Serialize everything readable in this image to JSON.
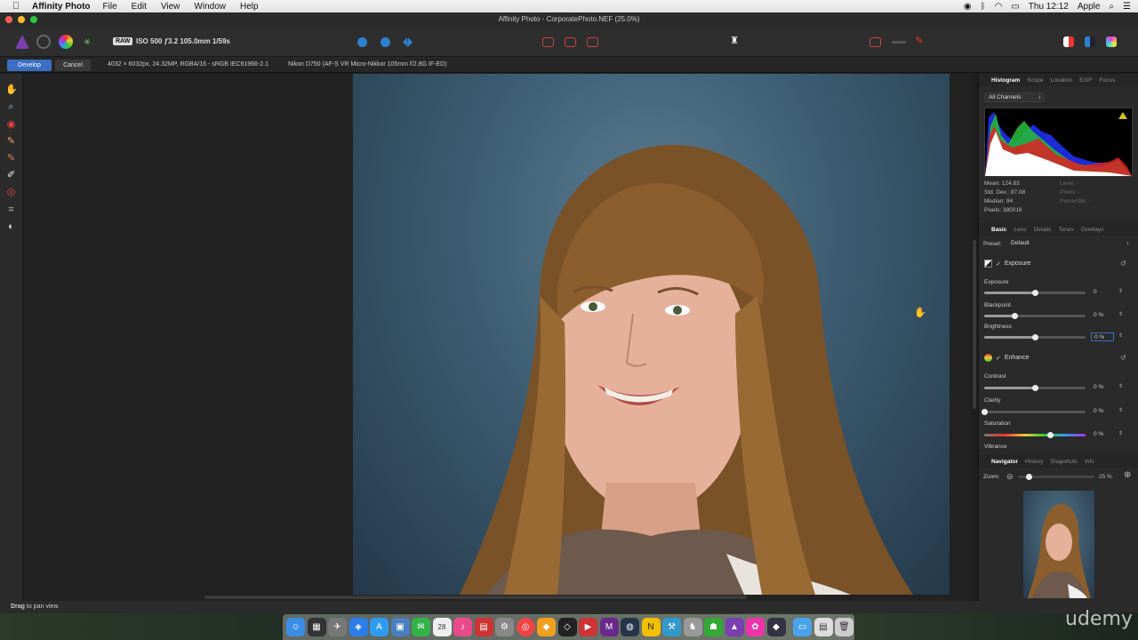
{
  "menubar": {
    "apple_icon": "",
    "app_name": "Affinity Photo",
    "items": [
      "File",
      "Edit",
      "View",
      "Window",
      "Help"
    ],
    "clock": "Thu 12:12",
    "user": "Apple"
  },
  "window": {
    "title": "Affinity Photo - CorporatePhoto.NEF (25.0%)"
  },
  "toolbar": {
    "raw_badge": "RAW",
    "exif_summary": "ISO 500 ƒ3.2 105.0mm 1/59s"
  },
  "context": {
    "develop_label": "Develop",
    "cancel_label": "Cancel",
    "image_info": "4032 × 6032px, 24.32MP, RGBA/16 - sRGB IEC61966-2.1",
    "camera_info": "Nikon D750 (AF-S VR Micro-Nikkor 105mm f/2.8G IF-ED)"
  },
  "histogram_panel": {
    "tabs": [
      "Histogram",
      "Scope",
      "Location",
      "EXIF",
      "Focus"
    ],
    "channel": "All Channels",
    "stats": {
      "mean": "Mean: 124.83",
      "std_dev": "Std. Dev.: 87.08",
      "median": "Median: 94",
      "pixels": "Pixels: 380016",
      "level": "Level: -",
      "pixels_sel": "Pixels: -",
      "percentile": "Percentile: -"
    }
  },
  "develop_panel": {
    "tabs": [
      "Basic",
      "Lens",
      "Details",
      "Tones",
      "Overlays"
    ],
    "preset_label": "Preset:",
    "preset_value": "Default",
    "exposure_section": "Exposure",
    "enhance_section": "Enhance",
    "sliders": {
      "exposure": {
        "label": "Exposure",
        "value": "0",
        "level": 0.5
      },
      "blackpoint": {
        "label": "Blackpoint",
        "value": "0 %",
        "level": 0.3
      },
      "brightness": {
        "label": "Brightness",
        "value": "0 %",
        "level": 0.5
      },
      "contrast": {
        "label": "Contrast",
        "value": "0 %",
        "level": 0.5
      },
      "clarity": {
        "label": "Clarity",
        "value": "0 %",
        "level": 0.0
      },
      "saturation": {
        "label": "Saturation",
        "value": "0 %",
        "level": 0.65
      },
      "vibrance": {
        "label": "Vibrance"
      }
    }
  },
  "navigator_panel": {
    "tabs": [
      "Navigator",
      "History",
      "Snapshots",
      "Info"
    ],
    "zoom_label": "Zoom:",
    "zoom_value": "25 %"
  },
  "status": {
    "bold": "Drag",
    "text": " to pan view."
  },
  "watermark": "udemy",
  "colors": {
    "accent": "#3b6fc4",
    "panel_bg": "#2a2a2a",
    "canvas_bg": "#222222"
  }
}
